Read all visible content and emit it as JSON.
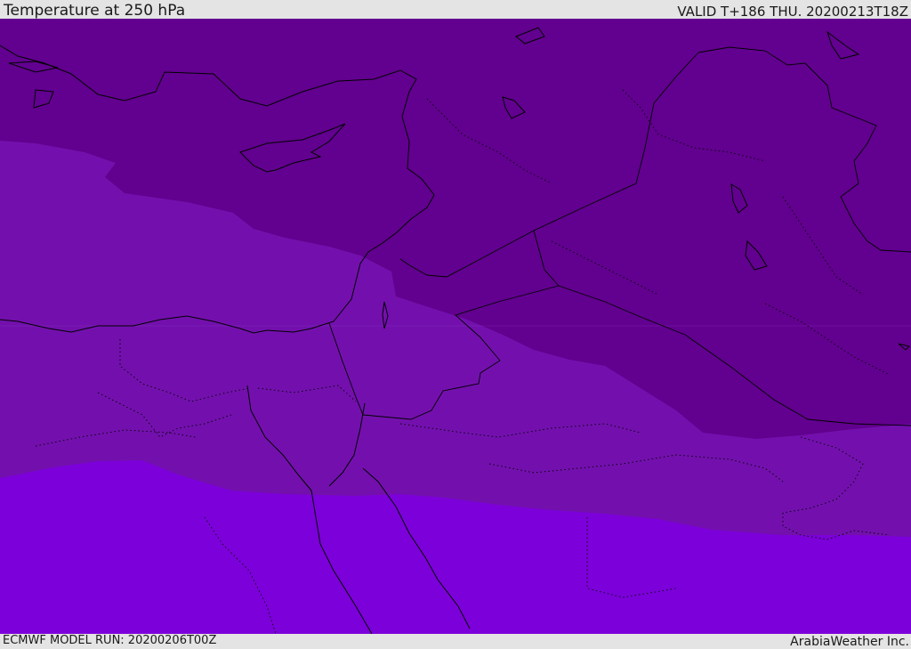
{
  "header": {
    "title": "Temperature at 250 hPa",
    "valid": "VALID T+186 THU. 20200213T18Z"
  },
  "footer": {
    "model_run": "ECMWF MODEL RUN: 20200206T00Z",
    "brand": "ArabiaWeather Inc."
  },
  "map": {
    "field_bands": [
      {
        "band": "coldest",
        "color": "#62008f"
      },
      {
        "band": "cold",
        "color": "#7310ad"
      },
      {
        "band": "mild",
        "color": "#7c00d9"
      }
    ],
    "coastline_color": "#000000",
    "border_style": "dotted"
  }
}
